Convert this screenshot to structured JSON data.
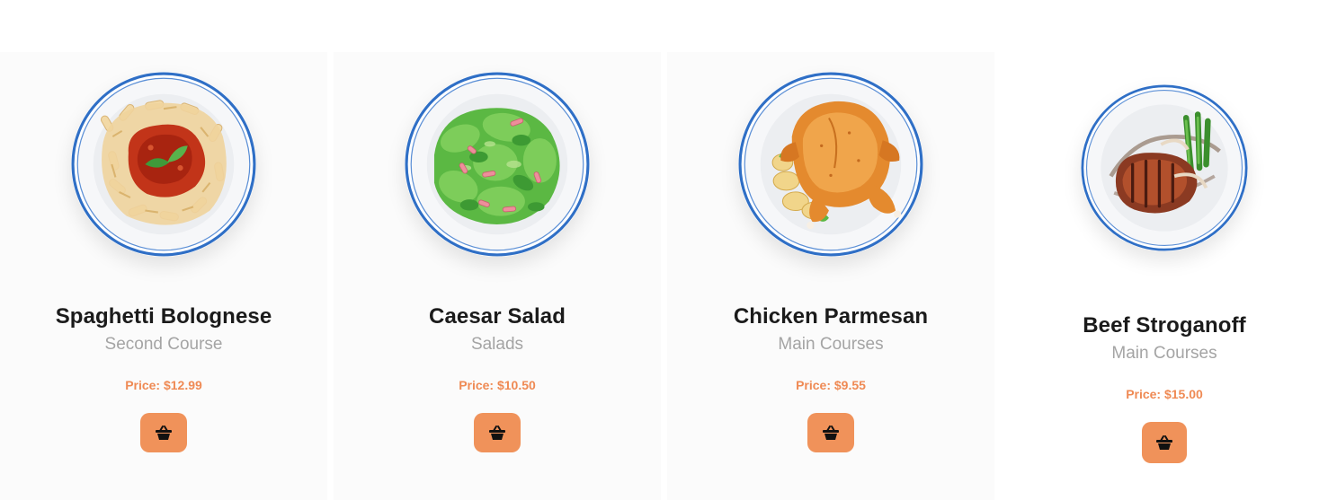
{
  "products": [
    {
      "name": "Spaghetti Bolognese",
      "category": "Second Course",
      "price": "Price: $12.99",
      "image_icon": "pasta-plate-icon",
      "cart_icon": "basket-icon"
    },
    {
      "name": "Caesar Salad",
      "category": "Salads",
      "price": "Price: $10.50",
      "image_icon": "salad-plate-icon",
      "cart_icon": "basket-icon"
    },
    {
      "name": "Chicken Parmesan",
      "category": "Main Courses",
      "price": "Price: $9.55",
      "image_icon": "roast-chicken-plate-icon",
      "cart_icon": "basket-icon"
    },
    {
      "name": "Beef Stroganoff",
      "category": "Main Courses",
      "price": "Price: $15.00",
      "image_icon": "steak-plate-icon",
      "cart_icon": "basket-icon"
    }
  ],
  "colors": {
    "accent": "#f0925a",
    "price": "#ef8a54",
    "plate_rim": "#2f6fc6",
    "title": "#1b1b1b",
    "muted": "#a4a4a4"
  }
}
